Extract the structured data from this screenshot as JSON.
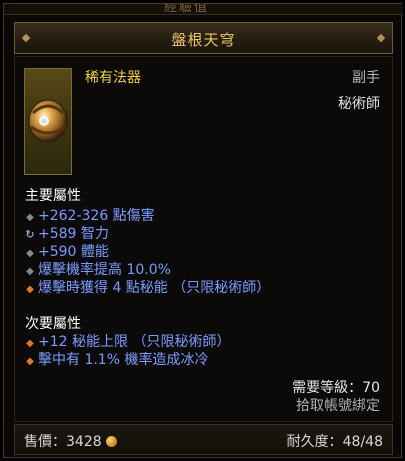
{
  "header": {
    "top_strip_text": "經驗值",
    "item_name": "盤根天穹"
  },
  "item": {
    "rarity": "稀有法器",
    "slot": "副手",
    "class": "秘術師"
  },
  "primary": {
    "title": "主要屬性",
    "stats": [
      {
        "bullet": "grey-diamond-icon",
        "text": "+262-326 點傷害"
      },
      {
        "bullet": "cycle-icon",
        "text": "+589 智力"
      },
      {
        "bullet": "grey-diamond-icon",
        "text": "+590 體能"
      },
      {
        "bullet": "grey-diamond-icon",
        "text": "爆擊機率提高 10.0%"
      },
      {
        "bullet": "orange-diamond-icon",
        "text": "爆擊時獲得 4 點秘能  （只限秘術師）"
      }
    ]
  },
  "secondary": {
    "title": "次要屬性",
    "stats": [
      {
        "bullet": "orange-diamond-icon",
        "text": "+12 秘能上限  （只限秘術師）"
      },
      {
        "bullet": "orange-diamond-icon",
        "text": "擊中有 1.1% 機率造成冰冷"
      }
    ]
  },
  "requirements": {
    "level": "需要等級：70",
    "binding": "拾取帳號綁定"
  },
  "footer": {
    "price": "售價：3428",
    "durability": "耐久度：48/48"
  },
  "colors": {
    "title_gold": "#e8c66a",
    "rarity_yellow": "#f0d24a",
    "stat_blue": "#7a9cff",
    "legendary_orange": "#e07a2a"
  }
}
